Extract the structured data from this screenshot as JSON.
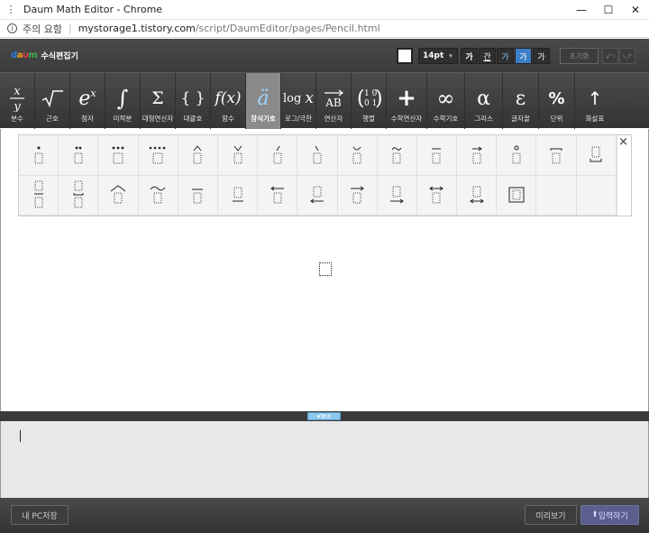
{
  "window": {
    "title": "Daum Math Editor - Chrome"
  },
  "address": {
    "warning": "주의 요함",
    "host": "mystorage1.tistory.com",
    "path": "/script/DaumEditor/pages/Pencil.html"
  },
  "header": {
    "brand_logo": "daum",
    "brand_name": "수식편집기",
    "font_size": "14pt",
    "format_buttons": [
      "가",
      "간",
      "가",
      "가",
      "가"
    ],
    "reset_label": "초기화",
    "undo_icon": "undo-icon",
    "redo_icon": "redo-icon"
  },
  "toolbar": {
    "tools": [
      {
        "name": "fraction",
        "symbol": "x/y",
        "label": "분수"
      },
      {
        "name": "root",
        "symbol": "√‾",
        "label": "근호"
      },
      {
        "name": "script",
        "symbol": "eˣ",
        "label": "첨자"
      },
      {
        "name": "calculus",
        "symbol": "∫",
        "label": "미적분"
      },
      {
        "name": "big-operator",
        "symbol": "Σ",
        "label": "대형연산자"
      },
      {
        "name": "bracket",
        "symbol": "{ }",
        "label": "대괄호"
      },
      {
        "name": "function",
        "symbol": "f(x)",
        "label": "함수"
      },
      {
        "name": "accent",
        "symbol": "ä",
        "label": "장식기호",
        "active": true
      },
      {
        "name": "log-limit",
        "symbol": "log x",
        "label": "로그/극한"
      },
      {
        "name": "operator",
        "symbol": "AB",
        "label": "연산자"
      },
      {
        "name": "matrix",
        "symbol": "(10 01)",
        "label": "행렬"
      },
      {
        "name": "math-operator",
        "symbol": "+",
        "label": "수학연산자"
      },
      {
        "name": "math-symbol",
        "symbol": "∞",
        "label": "수학기호"
      },
      {
        "name": "greek",
        "symbol": "α",
        "label": "그리스"
      },
      {
        "name": "letter-style",
        "symbol": "ε",
        "label": "글자꼴"
      },
      {
        "name": "unit",
        "symbol": "%",
        "label": "단위"
      },
      {
        "name": "arrow",
        "symbol": "↑",
        "label": "화살표"
      }
    ]
  },
  "palette": {
    "close_icon": "×",
    "row1": [
      "dot",
      "ddot",
      "dddot",
      "ddddot",
      "hat",
      "check",
      "acute",
      "grave",
      "breve",
      "tilde",
      "bar",
      "vec",
      "mathring",
      "overbrace-small",
      "underbrace-small"
    ],
    "row2": [
      "overline-stack",
      "underline-stack",
      "widehat",
      "widetilde",
      "overline",
      "underline",
      "overleftarrow",
      "underleftarrow",
      "overrightarrow",
      "underrightarrow",
      "overleftrightarrow",
      "underleftrightarrow",
      "boxed",
      "",
      ""
    ]
  },
  "divider": {
    "tex_label": "TeX"
  },
  "footer": {
    "save_label": "내 PC저장",
    "preview_label": "미리보기",
    "insert_label": "입력하기"
  }
}
